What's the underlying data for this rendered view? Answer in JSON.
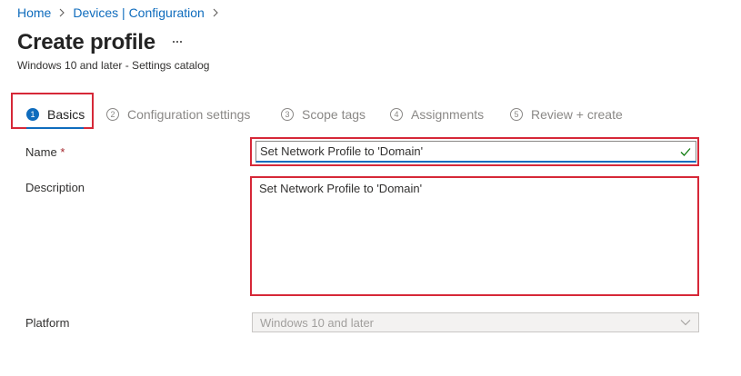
{
  "breadcrumb": {
    "items": [
      "Home",
      "Devices | Configuration"
    ]
  },
  "header": {
    "title": "Create profile",
    "more_label": "...",
    "subtitle": "Windows 10 and later - Settings catalog"
  },
  "steps": [
    {
      "number": "1",
      "label": "Basics",
      "active": true
    },
    {
      "number": "2",
      "label": "Configuration settings",
      "active": false
    },
    {
      "number": "3",
      "label": "Scope tags",
      "active": false
    },
    {
      "number": "4",
      "label": "Assignments",
      "active": false
    },
    {
      "number": "5",
      "label": "Review + create",
      "active": false
    }
  ],
  "form": {
    "name_label": "Name",
    "required_mark": "*",
    "name_value": "Set Network Profile to 'Domain'",
    "description_label": "Description",
    "description_value": "Set Network Profile to 'Domain'",
    "platform_label": "Platform",
    "platform_value": "Windows 10 and later"
  },
  "colors": {
    "accent": "#0f6cbd",
    "highlight": "#d62838",
    "required": "#a4262c",
    "disabled_text": "#a19f9d",
    "check": "#107c10"
  },
  "icons": [
    "chevron-right-icon",
    "more-icon",
    "check-icon",
    "chevron-down-icon"
  ]
}
